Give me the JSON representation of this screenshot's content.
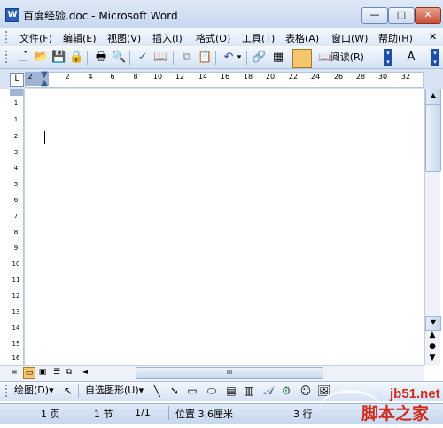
{
  "window": {
    "title": "百度经验.doc - Microsoft Word",
    "app_icon": "W"
  },
  "window_controls": {
    "minimize": "—",
    "maximize": "□",
    "close": "✕"
  },
  "menu": {
    "items": [
      "文件(F)",
      "编辑(E)",
      "视图(V)",
      "插入(I)",
      "格式(O)",
      "工具(T)",
      "表格(A)",
      "窗口(W)",
      "帮助(H)"
    ],
    "close_doc": "✕"
  },
  "toolbar": {
    "icons": [
      "new-doc-icon",
      "open-folder-icon",
      "save-icon",
      "permission-icon",
      "print-icon",
      "print-preview-icon",
      "spelling-icon",
      "research-icon",
      "copy-icon",
      "paste-icon",
      "undo-icon",
      "hyperlink-icon",
      "table-icon",
      "view-toggle-icon",
      "read-icon",
      "font-size-icon"
    ],
    "read_label": "阅读(R)",
    "undo_arrow": "▾",
    "font_label": "A"
  },
  "ruler": {
    "tab_selector": "L",
    "h_numbers": [
      "2",
      "2",
      "4",
      "6",
      "8",
      "10",
      "12",
      "14",
      "16",
      "18",
      "20",
      "22",
      "24",
      "26",
      "28",
      "30",
      "32"
    ],
    "v_numbers": [
      "1",
      "1",
      "2",
      "3",
      "4",
      "5",
      "6",
      "7",
      "8",
      "9",
      "10",
      "11",
      "12",
      "13",
      "14",
      "15",
      "16"
    ]
  },
  "scrollbar": {
    "up": "▲",
    "down": "▼",
    "prev_page": "▲",
    "select_browse": "●",
    "next_page": "▼",
    "left": "◄",
    "thumb_grip": "III"
  },
  "view_buttons": [
    "≡",
    "▭",
    "▣",
    "☰",
    "⧉"
  ],
  "drawing_toolbar": {
    "draw_label": "绘图(D)",
    "autoshapes_label": "自选图形(U)",
    "dropdown_arrow": "▾"
  },
  "status": {
    "page": "1 页",
    "section": "1 节",
    "page_of": "1/1",
    "position": "位置 3.6厘米",
    "line": "3 行"
  },
  "watermark": {
    "site": "jb51.net",
    "text": "脚本之家"
  }
}
